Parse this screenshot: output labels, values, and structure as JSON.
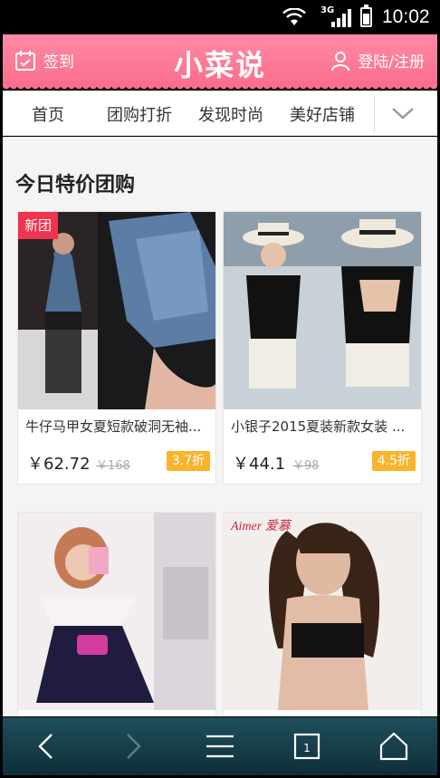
{
  "status_bar": {
    "network": "3G",
    "time": "10:02"
  },
  "header": {
    "checkin_label": "签到",
    "logo_text": "小菜说",
    "login_label": "登陆/注册"
  },
  "nav": {
    "tabs": [
      "首页",
      "团购打折",
      "发现时尚",
      "美好店铺"
    ]
  },
  "section": {
    "title": "今日特价团购"
  },
  "products": [
    {
      "tag": "新团",
      "name": "牛仔马甲女夏短款破洞无袖...",
      "price": "￥62.72",
      "original": "￥168",
      "discount": "3.7折"
    },
    {
      "tag": "",
      "name": "小银子2015夏装新款女装 ...",
      "price": "￥44.1",
      "original": "￥98",
      "discount": "4.5折"
    },
    {
      "tag": "",
      "name": "",
      "price": "",
      "original": "",
      "discount": ""
    },
    {
      "tag": "",
      "name": "",
      "price": "",
      "original": "",
      "discount": "",
      "brand_text": "Aimer 爱慕"
    }
  ],
  "colors": {
    "header_pink": "#fb6f8e",
    "discount_orange": "#f9b42a",
    "tag_red": "#f0334e",
    "bottom_bar": "#1f4f5c"
  },
  "icons": [
    "wifi-icon",
    "signal-icon",
    "battery-icon",
    "calendar-icon",
    "user-icon",
    "chevron-down-icon",
    "back-icon",
    "forward-icon",
    "menu-icon",
    "tabs-icon",
    "home-icon"
  ]
}
